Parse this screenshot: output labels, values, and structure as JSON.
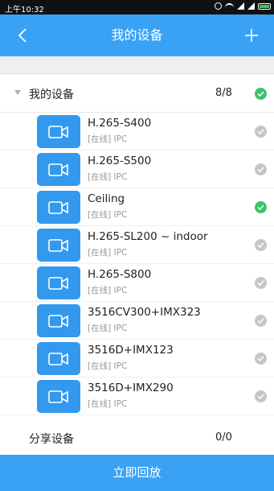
{
  "status_bar": {
    "time": "上午10:32",
    "icons": [
      "alarm-icon",
      "wifi-icon",
      "signal-icon",
      "signal-icon",
      "battery-icon"
    ]
  },
  "header": {
    "title": "我的设备",
    "back_icon": "chevron-left-icon",
    "add_icon": "plus-icon"
  },
  "group": {
    "title": "我的设备",
    "count": "8/8",
    "all_selected": true
  },
  "devices": [
    {
      "name": "H.265-S400",
      "status": "[在线] IPC",
      "selected": false
    },
    {
      "name": "H.265-S500",
      "status": "[在线] IPC",
      "selected": false
    },
    {
      "name": "Ceiling",
      "status": "[在线] IPC",
      "selected": true
    },
    {
      "name": "H.265-SL200 ~ indoor",
      "status": "[在线] IPC",
      "selected": false
    },
    {
      "name": "H.265-S800",
      "status": "[在线] IPC",
      "selected": false
    },
    {
      "name": "3516CV300+IMX323",
      "status": "[在线] IPC",
      "selected": false
    },
    {
      "name": "3516D+IMX123",
      "status": "[在线] IPC",
      "selected": false
    },
    {
      "name": "3516D+IMX290",
      "status": "[在线] IPC",
      "selected": false
    }
  ],
  "shared": {
    "title": "分享设备",
    "count": "0/0"
  },
  "footer": {
    "playback_label": "立即回放"
  },
  "colors": {
    "accent": "#39a2f5",
    "camera_tile": "#3399ee",
    "check_on": "#3cc46a",
    "check_off": "#c6c6c6"
  }
}
